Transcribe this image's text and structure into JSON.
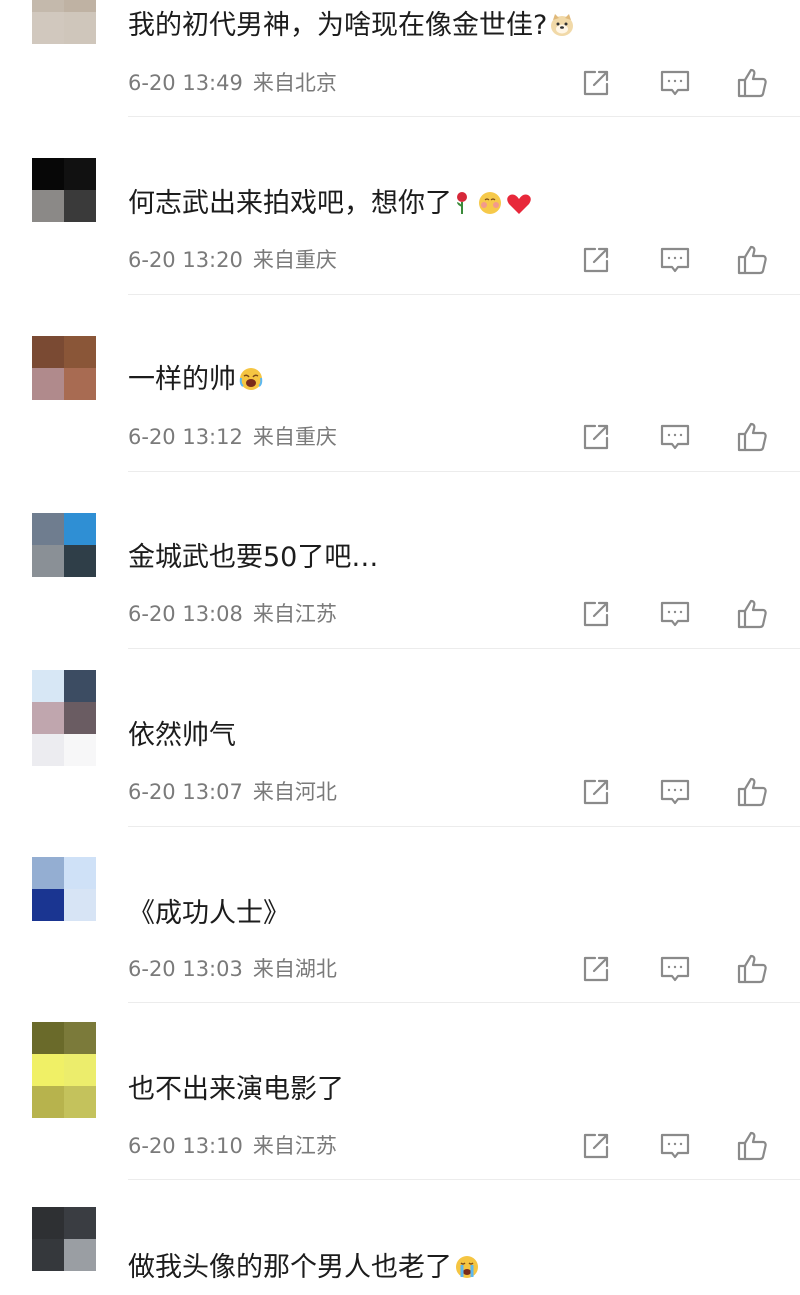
{
  "comments": [
    {
      "text": "我的初代男神，为啥现在像金世佳?",
      "emoji": "doge-icon",
      "time": "6-20 13:49",
      "location": "来自北京",
      "avatar_colors": [
        "#c4b9ac",
        "#bfb2a3",
        "#d1c8be",
        "#cfc6bb"
      ]
    },
    {
      "text": "何志武出来拍戏吧，想你了",
      "emoji": "rose-blush-heart-icons",
      "time": "6-20 13:20",
      "location": "来自重庆",
      "avatar_colors": [
        "#070707",
        "#111111",
        "#8b8987",
        "#3a3a3a"
      ]
    },
    {
      "text": "一样的帅",
      "emoji": "crying-laugh-icon",
      "time": "6-20 13:12",
      "location": "来自重庆",
      "avatar_colors": [
        "#7a4a33",
        "#8a5638",
        "#b08a8c",
        "#a86b52"
      ]
    },
    {
      "text": "金城武也要50了吧…",
      "emoji": "",
      "time": "6-20 13:08",
      "location": "来自江苏",
      "avatar_colors": [
        "#6f7d8f",
        "#2f8fd4",
        "#8a9096",
        "#2f3e48"
      ]
    },
    {
      "text": "依然帅气",
      "emoji": "",
      "time": "6-20 13:07",
      "location": "来自河北",
      "avatar_colors": [
        "#d7e7f5",
        "#3c4c62",
        "#c0a6ae",
        "#6a5c62",
        "#ececf0",
        "#f7f7f8"
      ]
    },
    {
      "text": "《成功人士》",
      "emoji": "",
      "time": "6-20 13:03",
      "location": "来自湖北",
      "avatar_colors": [
        "#94aed2",
        "#cfe1f7",
        "#1a3591",
        "#d7e4f5"
      ]
    },
    {
      "text": "也不出来演电影了",
      "emoji": "",
      "time": "6-20 13:10",
      "location": "来自江苏",
      "avatar_colors": [
        "#6a6a2a",
        "#7b7a3a",
        "#f0f066",
        "#eced6c",
        "#b7b34d",
        "#c4c25c"
      ]
    },
    {
      "text": "做我头像的那个男人也老了",
      "emoji": "crying-icon",
      "time": "",
      "location": "",
      "avatar_colors": [
        "#2e3033",
        "#3a3d42",
        "#35383c",
        "#9a9ea3"
      ]
    }
  ],
  "actions": {
    "share_icon": "share-icon",
    "reply_icon": "comment-icon",
    "like_icon": "thumbs-up-icon"
  }
}
